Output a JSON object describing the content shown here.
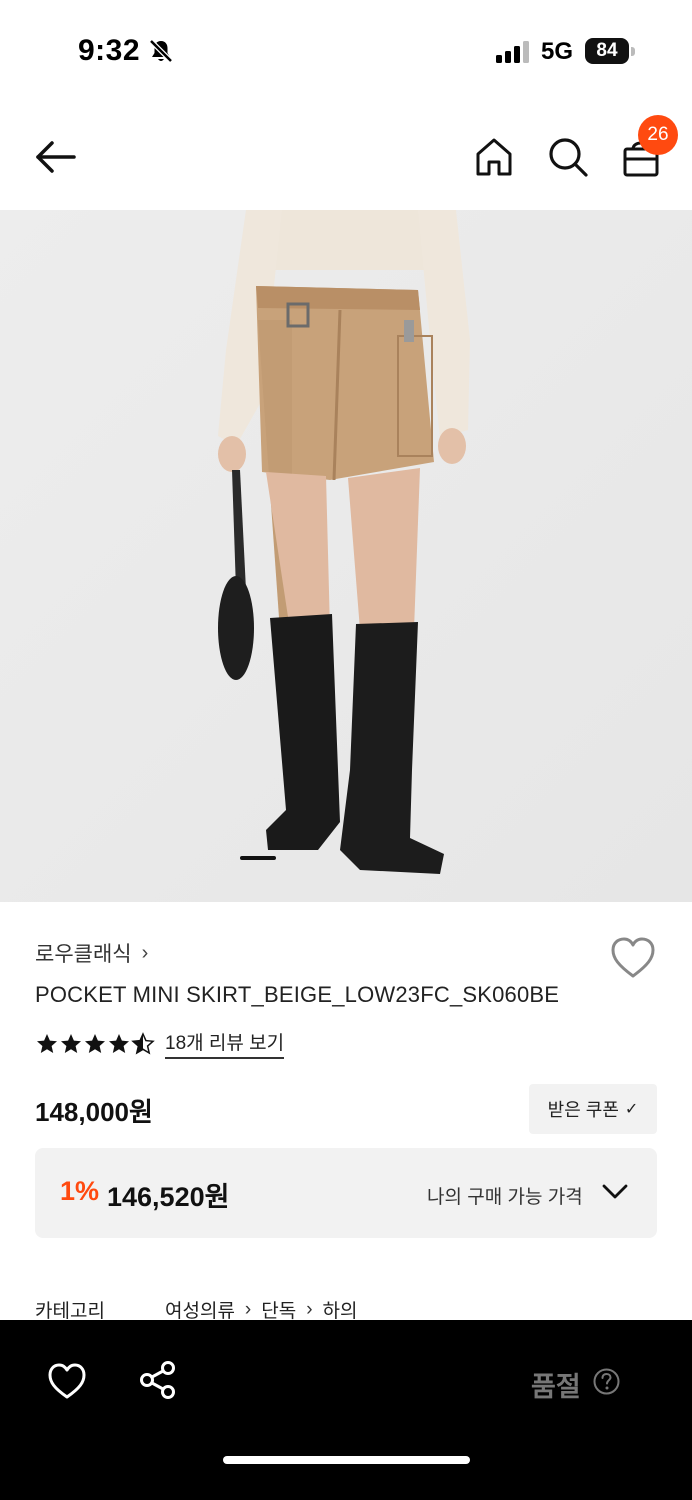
{
  "status_bar": {
    "time": "9:32",
    "network": "5G",
    "battery": "84"
  },
  "header": {
    "cart_count": "26"
  },
  "product": {
    "brand": "로우클래식",
    "name": "POCKET MINI SKIRT_BEIGE_LOW23FC_SK060BE",
    "rating": 4.5,
    "review_link": "18개 리뷰 보기",
    "price": "148,000원",
    "coupon_button": "받은 쿠폰",
    "my_price": {
      "discount": "1%",
      "price": "146,520원",
      "label": "나의 구매 가능 가격"
    },
    "category": {
      "label": "카테고리",
      "path": [
        "여성의류",
        "단독",
        "하의"
      ]
    }
  },
  "bottom_bar": {
    "soldout": "품절"
  },
  "colors": {
    "accent": "#ff4a10",
    "background_hero": "#ececec",
    "bottom_bar": "#000000"
  }
}
